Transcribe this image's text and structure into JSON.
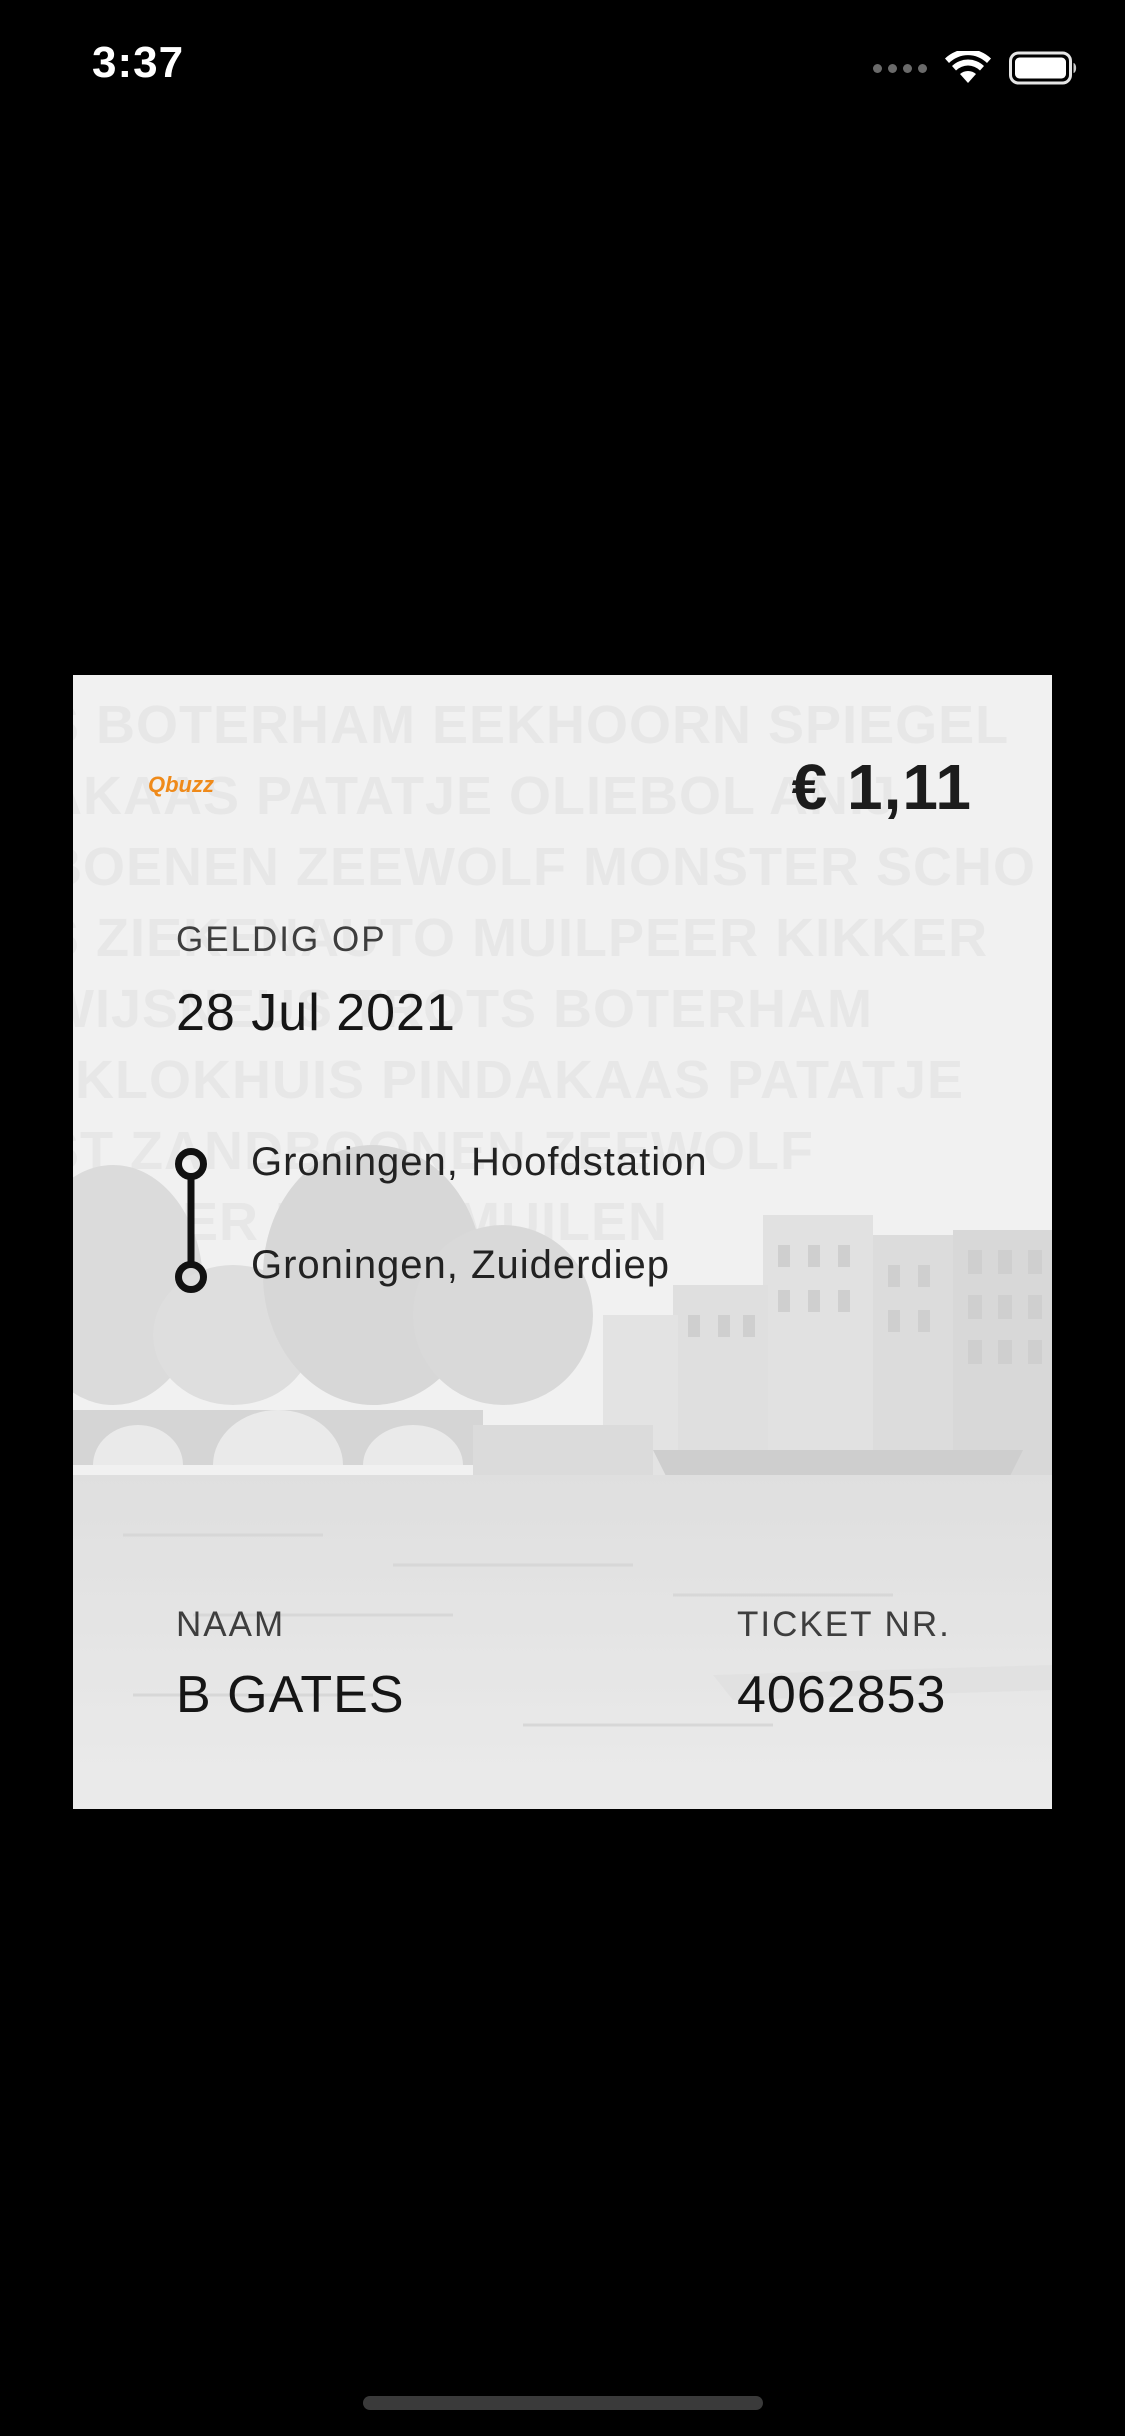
{
  "status_bar": {
    "time": "3:37",
    "icons": [
      "cellular-signal-icon",
      "wifi-icon",
      "battery-icon"
    ]
  },
  "ticket": {
    "brand": "Qbuzz",
    "price": "€ 1,11",
    "valid_label": "GELDIG OP",
    "valid_date": "28 Jul 2021",
    "route": {
      "from": "Groningen, Hoofdstation",
      "to": "Groningen, Zuiderdiep"
    },
    "name_label": "NAAM",
    "name_value": "B GATES",
    "ticket_label": "TICKET NR.",
    "ticket_value": "4062853",
    "background_words": [
      "S BOTERHAM EEKHOORN SPIEGEL",
      "AKAAS PATATJE OLIEBOL ANIJ",
      "BOENEN ZEEWOLF MONSTER SCHO",
      "S ZIEKENAUTO MUILPEER KIKKER",
      "WIJSNEUS TROTS BOTERHAM",
      "I KLOKHUIS PINDAKAAS PATATJE",
      "ST ZANDBOONEN ZEEWOLF",
      "MIEDER DIELS MUILEN"
    ],
    "accent_color": "#ef8a1a"
  }
}
